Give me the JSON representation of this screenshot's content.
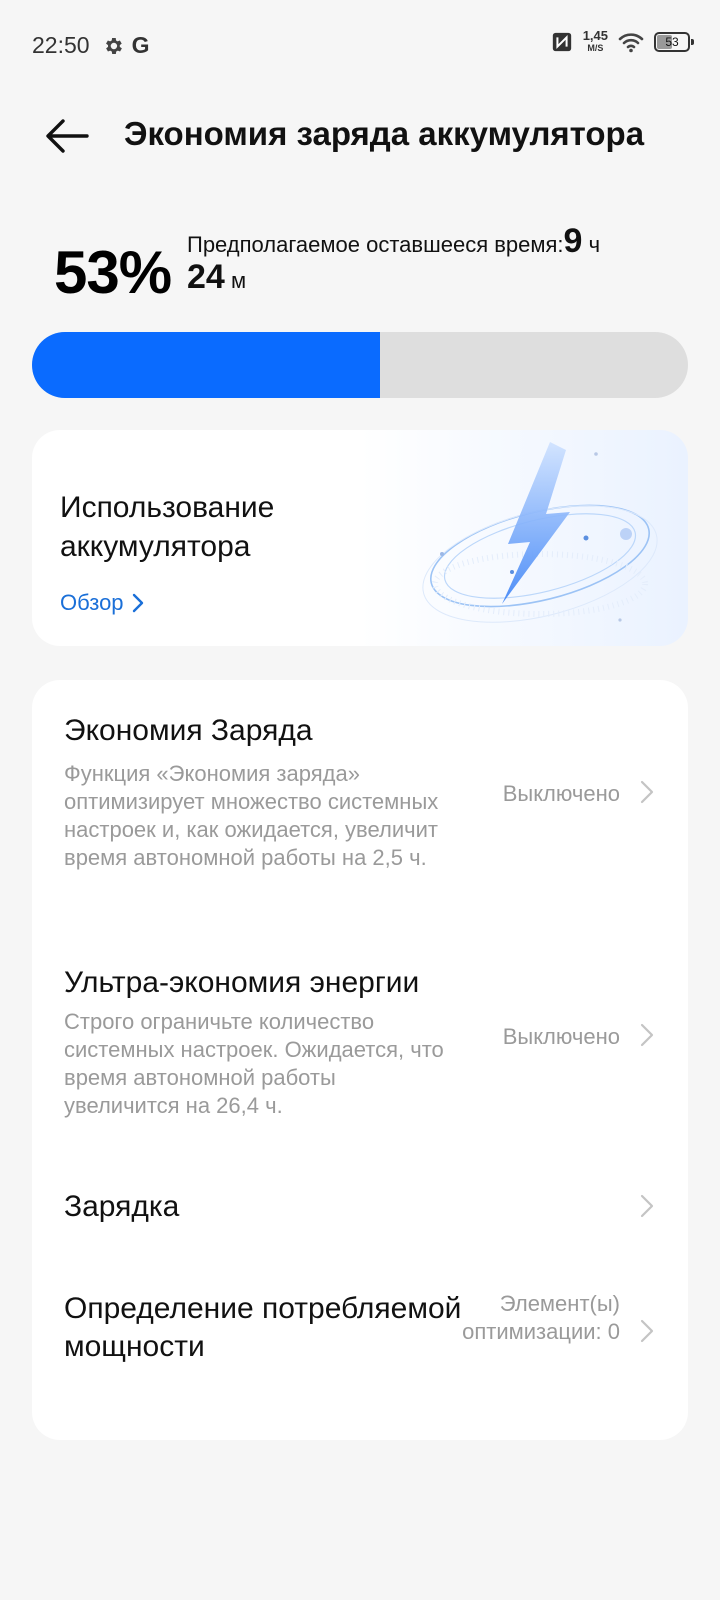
{
  "status_bar": {
    "time": "22:50",
    "g_letter": "G",
    "speed_value": "1,45",
    "speed_unit": "M/S",
    "battery_level": "53"
  },
  "header": {
    "title": "Экономия заряда аккумулятора"
  },
  "summary": {
    "percent": "53%",
    "percent_value": 53,
    "estimate_label": "Предполагаемое оставшееся время:",
    "hours_value": "9",
    "hours_unit": "ч",
    "minutes_value": "24",
    "minutes_unit": "м"
  },
  "usage_card": {
    "title": "Использование аккумулятора",
    "link_label": "Обзор"
  },
  "settings": {
    "items": [
      {
        "title": "Экономия Заряда",
        "description": "Функция «Экономия заряда» оптимизирует множество системных настроек и, как ожидается, увеличит время автономной работы на 2,5 ч.",
        "value": "Выключено"
      },
      {
        "title": "Ультра-экономия энергии",
        "description": "Строго ограничьте количество системных настроек. Ожидается, что время автономной работы увеличится на 26,4 ч.",
        "value": "Выключено"
      },
      {
        "title": "Зарядка"
      },
      {
        "title": "Определение потребляемой мощности",
        "value": "Элемент(ы) оптимизации: 0"
      }
    ]
  }
}
